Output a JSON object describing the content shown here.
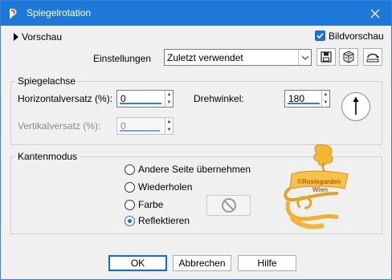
{
  "window": {
    "title": "Spiegelrotation",
    "accent": "#1e78d7"
  },
  "header": {
    "vorschau_label": "Vorschau",
    "bildvorschau_label": "Bildvorschau",
    "bildvorschau_checked": true,
    "einstellungen_label": "Einstellungen",
    "einstellungen_value": "Zuletzt verwendet"
  },
  "spiegelachse": {
    "title": "Spiegelachse",
    "horizontal_label": "Horizontalversatz (%):",
    "horizontal_value": "0",
    "vertikal_label": "Vertikalversatz (%):",
    "vertikal_value": "0",
    "drehwinkel_label": "Drehwinkel:",
    "drehwinkel_value": "180"
  },
  "kantenmodus": {
    "title": "Kantenmodus",
    "options": [
      {
        "label": "Andere Seite übernehmen",
        "selected": false
      },
      {
        "label": "Wiederholen",
        "selected": false
      },
      {
        "label": "Farbe",
        "selected": false
      },
      {
        "label": "Reflektieren",
        "selected": true
      }
    ]
  },
  "watermark": {
    "text_line1": "©Rosiegarden",
    "text_line2": "Wien"
  },
  "footer": {
    "ok_label": "OK",
    "abbrechen_label": "Abbrechen",
    "hilfe_label": "Hilfe"
  },
  "icons": [
    "app-icon",
    "close-icon",
    "play-triangle-icon",
    "checkbox-check-icon",
    "chevron-down-icon",
    "save-preset-icon",
    "reset-preset-icon",
    "manage-presets-icon",
    "angle-dial-icon",
    "no-color-icon",
    "watermark-logo"
  ]
}
